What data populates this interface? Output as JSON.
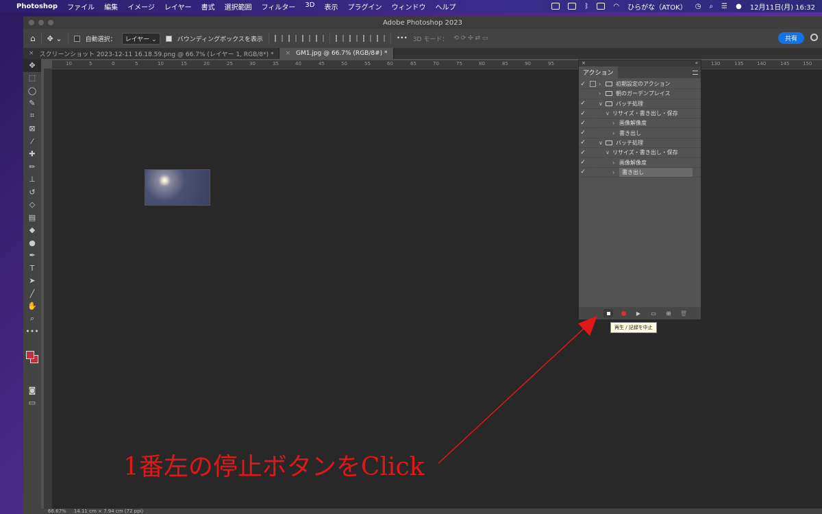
{
  "menubar": {
    "app": "Photoshop",
    "items": [
      "ファイル",
      "編集",
      "イメージ",
      "レイヤー",
      "書式",
      "選択範囲",
      "フィルター",
      "3D",
      "表示",
      "プラグイン",
      "ウィンドウ",
      "ヘルプ"
    ],
    "input_method": "ひらがな（ATOK）",
    "datetime": "12月11日(月)  16:32"
  },
  "window": {
    "title": "Adobe Photoshop 2023"
  },
  "options_bar": {
    "auto_select_label": "自動選択：",
    "auto_select_value": "レイヤー",
    "bounding_box_label": "バウンディングボックスを表示",
    "mode_3d_label": "3D モード：",
    "share_label": "共有"
  },
  "tabs": [
    {
      "label": "スクリーンショット 2023-12-11 16.18.59.png @ 66.7% (レイヤー 1, RGB/8*) *"
    },
    {
      "label": "GM1.jpg @ 66.7% (RGB/8#) *"
    }
  ],
  "ruler_ticks": [
    "10",
    "5",
    "0",
    "5",
    "10",
    "15",
    "20",
    "25",
    "30",
    "35",
    "40",
    "45",
    "50",
    "55",
    "60",
    "65",
    "70",
    "75",
    "80",
    "85",
    "90",
    "95",
    "130",
    "135",
    "140",
    "145",
    "150"
  ],
  "actions_panel": {
    "tab_label": "アクション",
    "rows": [
      {
        "checked": true,
        "dialog": true,
        "indent": 0,
        "arrow": "›",
        "folder": true,
        "label": "初期設定のアクション"
      },
      {
        "checked": false,
        "dialog": false,
        "indent": 0,
        "arrow": "›",
        "folder": true,
        "label": "朝のガーデンプレイス"
      },
      {
        "checked": true,
        "dialog": false,
        "indent": 0,
        "arrow": "∨",
        "folder": true,
        "label": "バッチ処理"
      },
      {
        "checked": true,
        "dialog": false,
        "indent": 1,
        "arrow": "∨",
        "folder": false,
        "label": "リサイズ・書き出し・保存"
      },
      {
        "checked": true,
        "dialog": false,
        "indent": 2,
        "arrow": "›",
        "folder": false,
        "label": "画像解像度"
      },
      {
        "checked": true,
        "dialog": false,
        "indent": 2,
        "arrow": "›",
        "folder": false,
        "label": "書き出し"
      },
      {
        "checked": true,
        "dialog": false,
        "indent": 0,
        "arrow": "∨",
        "folder": true,
        "label": "バッチ処理"
      },
      {
        "checked": true,
        "dialog": false,
        "indent": 1,
        "arrow": "∨",
        "folder": false,
        "label": "リサイズ・書き出し・保存"
      },
      {
        "checked": true,
        "dialog": false,
        "indent": 2,
        "arrow": "›",
        "folder": false,
        "label": "画像解像度"
      },
      {
        "checked": true,
        "dialog": false,
        "indent": 2,
        "arrow": "›",
        "folder": false,
        "label": "書き出し",
        "selected": true
      }
    ],
    "tooltip": "再生 / 記録を中止"
  },
  "statusbar": {
    "zoom": "66.67%",
    "size": "14.11 cm × 7.94 cm (72 ppi)"
  },
  "annotation": {
    "text": "1番左の停止ボタンをClick",
    "color": "#e01818"
  }
}
